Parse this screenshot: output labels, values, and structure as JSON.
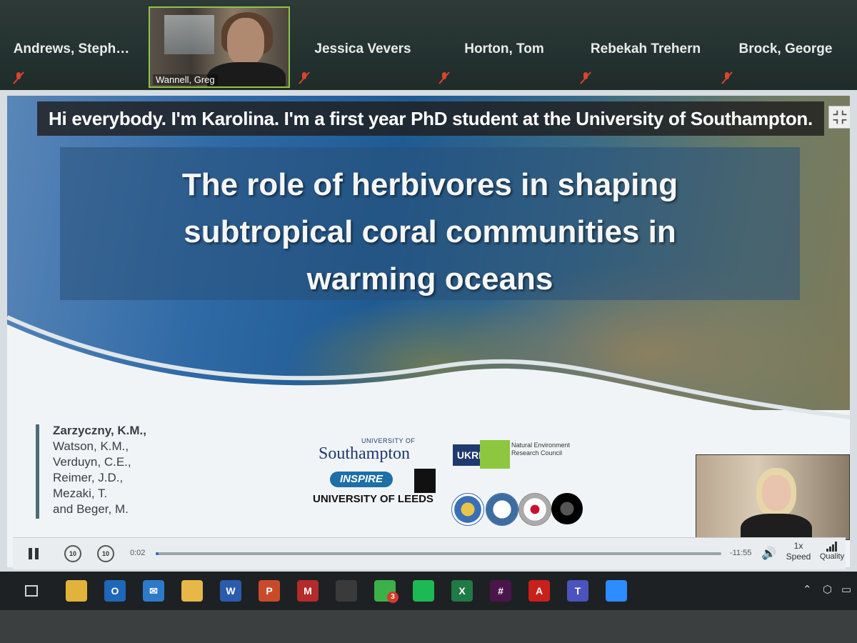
{
  "participants": [
    {
      "name": "Andrews,  Steph…",
      "muted": true
    },
    {
      "name": "Wannell, Greg",
      "video": true
    },
    {
      "name": "Jessica Vevers",
      "muted": true
    },
    {
      "name": "Horton, Tom",
      "muted": true
    },
    {
      "name": "Rebekah Trehern",
      "muted": true
    },
    {
      "name": "Brock, George",
      "muted": true
    }
  ],
  "caption": "Hi everybody. I'm Karolina. I'm a first year PhD student at the University of Southampton.",
  "slide": {
    "title_lines": [
      "The role of herbivores in shaping",
      "subtropical coral communities in",
      "warming oceans"
    ],
    "authors": [
      "Zarzyczny, K.M.,",
      "Watson, K.M.,",
      "Verduyn, C.E.,",
      "Reimer, J.D.,",
      "Mezaki, T.",
      "and Beger, M."
    ],
    "logos": {
      "soton_small": "UNIVERSITY OF",
      "soton": "Southampton",
      "inspire": "INSPIRE",
      "leeds": "UNIVERSITY OF LEEDS",
      "ukri": "UKRI",
      "nerc": "Natural Environment Research Council"
    }
  },
  "player": {
    "elapsed": "0:02",
    "remaining": "-11:55",
    "progress_fraction": 0.003,
    "skip_back": "10",
    "skip_forward": "10",
    "speed_value": "1x",
    "speed_label": "Speed",
    "quality_label": "Quality"
  },
  "taskbar": {
    "apps": [
      {
        "name": "chrome",
        "label": "",
        "color": "#e2b33a"
      },
      {
        "name": "outlook",
        "label": "O",
        "color": "#1f67b8"
      },
      {
        "name": "mail",
        "label": "✉",
        "color": "#2d7ac9"
      },
      {
        "name": "file-explorer",
        "label": "",
        "color": "#e7b847"
      },
      {
        "name": "word",
        "label": "W",
        "color": "#2b5bac"
      },
      {
        "name": "powerpoint",
        "label": "P",
        "color": "#c94a2a"
      },
      {
        "name": "mendeley",
        "label": "M",
        "color": "#b52a2a"
      },
      {
        "name": "inkscape",
        "label": "",
        "color": "#3a3a3a"
      },
      {
        "name": "whatsapp",
        "label": "",
        "color": "#3bb14a"
      },
      {
        "name": "spotify",
        "label": "",
        "color": "#1db954"
      },
      {
        "name": "excel",
        "label": "X",
        "color": "#1f7a45"
      },
      {
        "name": "slack",
        "label": "#",
        "color": "#4a154b"
      },
      {
        "name": "acrobat",
        "label": "A",
        "color": "#c8201b"
      },
      {
        "name": "teams",
        "label": "T",
        "color": "#4b53bc"
      },
      {
        "name": "zoom",
        "label": "",
        "color": "#2d8cff"
      }
    ],
    "whatsapp_badge": "3"
  }
}
